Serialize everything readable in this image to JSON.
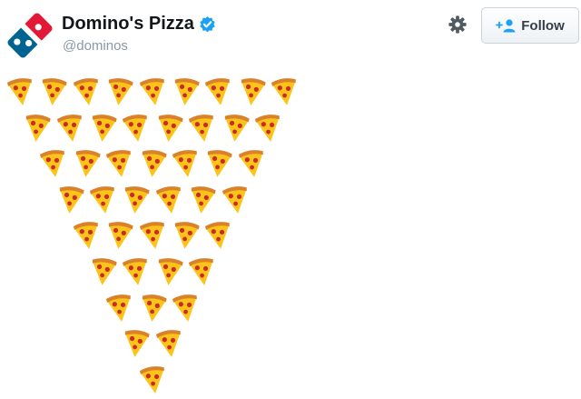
{
  "profile": {
    "display_name": "Domino's Pizza",
    "handle": "@dominos",
    "verified": true
  },
  "actions": {
    "follow_label": "Follow",
    "follow_icon": "add-user-icon",
    "settings_icon": "gear-icon"
  },
  "tweet": {
    "emoji": "pizza-slice",
    "row_counts": [
      9,
      8,
      7,
      6,
      5,
      4,
      3,
      2,
      1
    ]
  },
  "colors": {
    "brand_blue": "#006491",
    "brand_red": "#e31837",
    "verified_blue": "#1da1f2",
    "crust": "#d9822b",
    "cheese": "#fcc419",
    "pepperoni": "#c92a2a"
  }
}
